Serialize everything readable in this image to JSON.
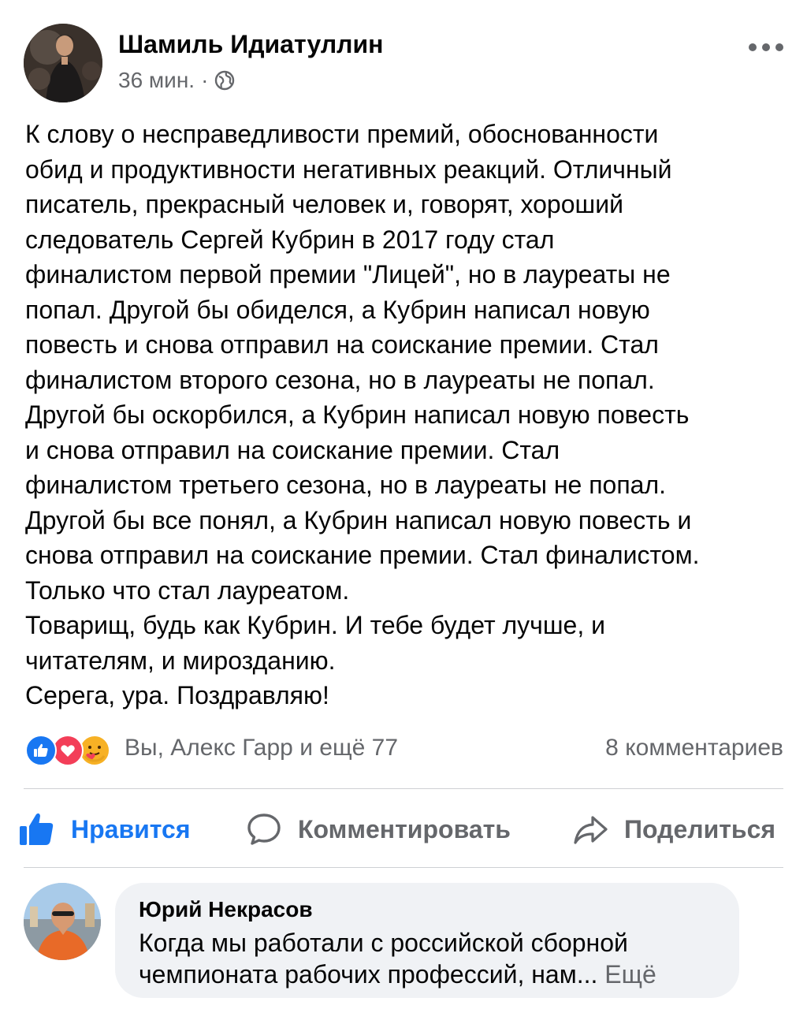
{
  "post": {
    "author": "Шамиль Идиатуллин",
    "time": "36 мин.",
    "meta_separator": "·",
    "privacy_icon": "globe-icon",
    "more_icon": "more-dots-icon",
    "text_lines": [
      "К слову о несправедливости премий, обоснованности",
      "обид и продуктивности негативных реакций. Отличный",
      "писатель, прекрасный человек и, говорят, хороший",
      "следователь Сергей Кубрин в 2017 году стал",
      "финалистом первой премии \"Лицей\", но в лауреаты не",
      "попал. Другой бы обиделся, а Кубрин написал новую",
      "повесть и снова отправил на соискание премии. Стал",
      "финалистом второго сезона, но в лауреаты не попал.",
      "Другой бы оскорбился, а Кубрин написал новую повесть",
      "и снова отправил на соискание премии. Стал",
      "финалистом третьего сезона, но в лауреаты не попал.",
      "Другой бы все понял, а Кубрин написал новую повесть и",
      "снова отправил на соискание премии. Стал финалистом.",
      "Только что стал лауреатом.",
      "Товарищ, будь как Кубрин. И тебе будет лучше, и",
      "читателям, и мирозданию.",
      "Серега, ура. Поздравляю!"
    ]
  },
  "reactions": {
    "icons": [
      "like-reaction-icon",
      "love-reaction-icon",
      "care-reaction-icon"
    ],
    "summary": "Вы, Алекс Гарр и ещё 77",
    "comments": "8 комментариев"
  },
  "actions": {
    "like": "Нравится",
    "comment": "Комментировать",
    "share": "Поделиться"
  },
  "comment": {
    "author": "Юрий Некрасов",
    "text_lines": [
      "Когда мы работали с российской сборной",
      "чемпионата рабочих профессий, нам..."
    ],
    "see_more": "Ещё"
  },
  "colors": {
    "accent": "#1877f2",
    "secondary_text": "#65676b",
    "bubble": "#f0f2f5",
    "love": "#f33e58",
    "care": "#f7b125"
  }
}
